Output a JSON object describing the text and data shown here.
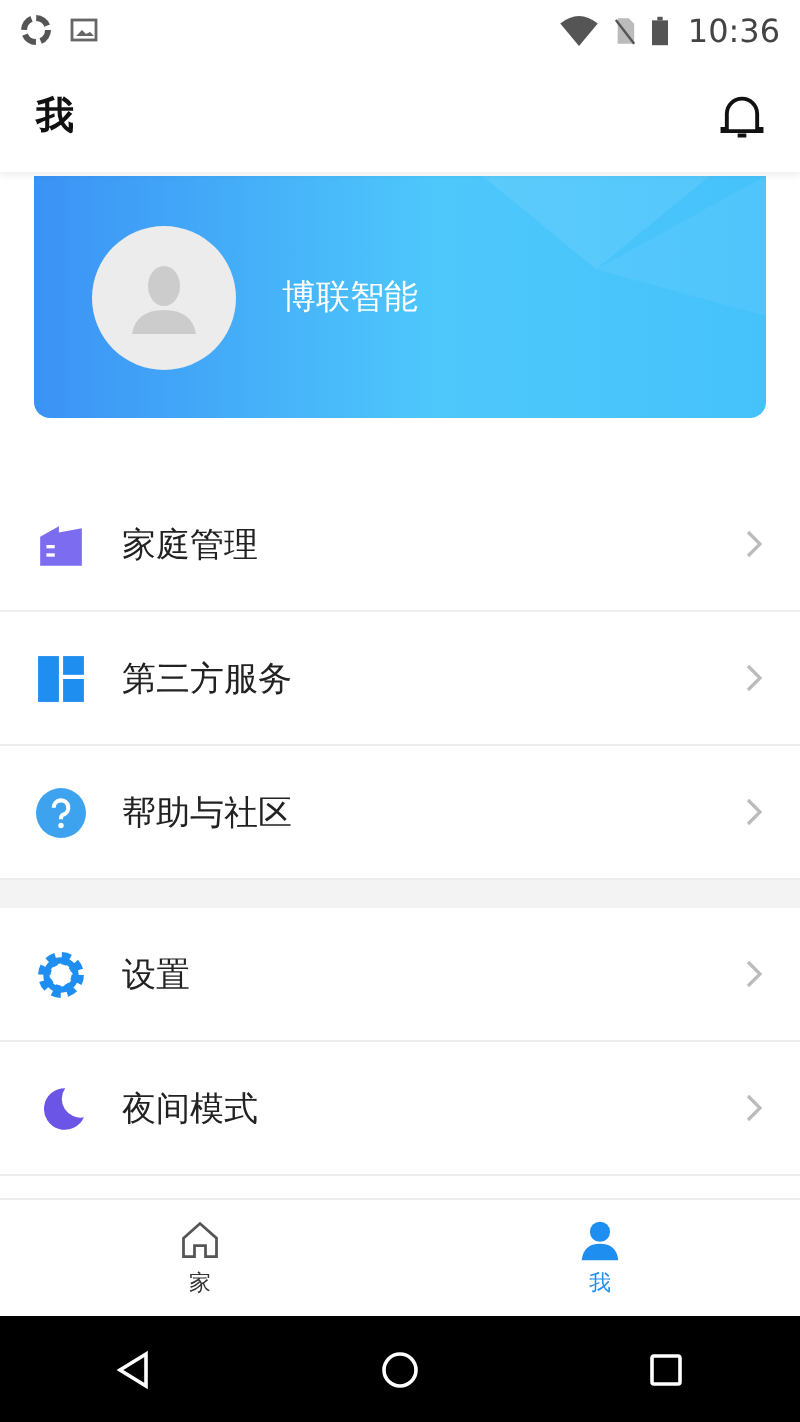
{
  "status_bar": {
    "time": "10:36"
  },
  "header": {
    "title": "我"
  },
  "profile": {
    "name": "博联智能"
  },
  "menu_groups": [
    [
      {
        "kind": "home",
        "label": "家庭管理"
      },
      {
        "kind": "services",
        "label": "第三方服务"
      },
      {
        "kind": "help",
        "label": "帮助与社区"
      }
    ],
    [
      {
        "kind": "settings",
        "label": "设置"
      },
      {
        "kind": "night",
        "label": "夜间模式"
      }
    ]
  ],
  "tabs": [
    {
      "kind": "home",
      "label": "家",
      "selected": false
    },
    {
      "kind": "me",
      "label": "我",
      "selected": true
    }
  ]
}
